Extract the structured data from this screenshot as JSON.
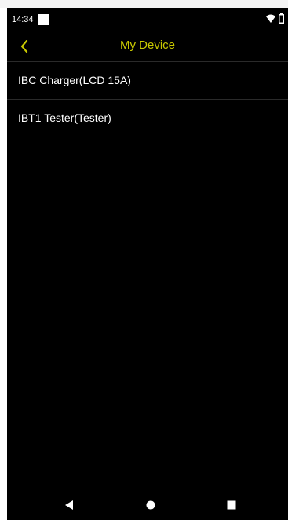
{
  "status_bar": {
    "time": "14:34",
    "icons": [
      "notification-square-icon",
      "wifi-icon",
      "battery-icon"
    ]
  },
  "header": {
    "title": "My Device",
    "back_icon": "chevron-left-icon"
  },
  "devices": [
    {
      "label": "IBC Charger(LCD 15A)"
    },
    {
      "label": "IBT1 Tester(Tester)"
    }
  ],
  "nav_bar": {
    "icons": [
      "nav-back-icon",
      "nav-home-icon",
      "nav-recents-icon"
    ]
  },
  "colors": {
    "background": "#000000",
    "accent": "#c8c800",
    "text": "#ffffff",
    "divider": "#2a2a2a"
  }
}
